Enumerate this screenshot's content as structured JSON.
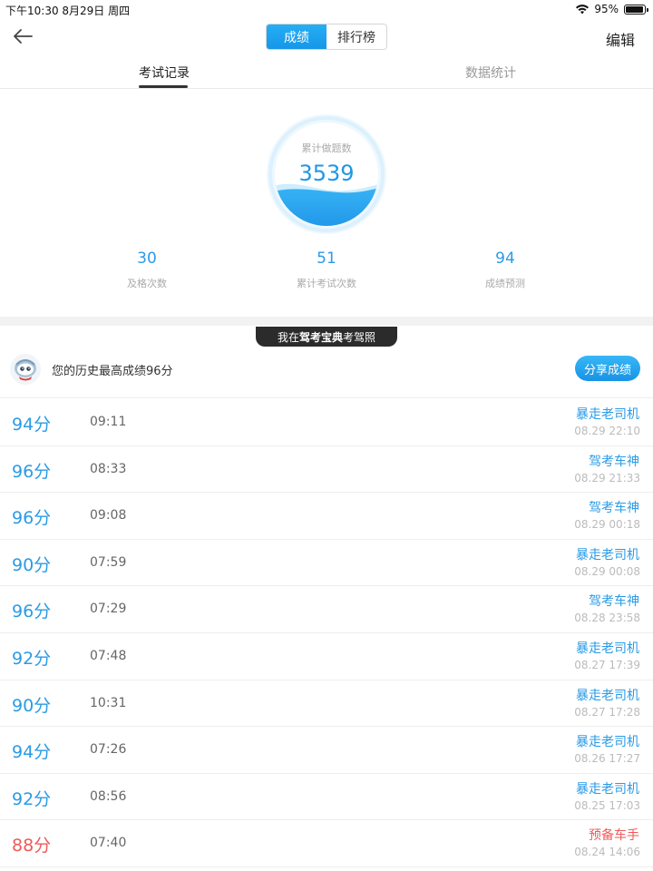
{
  "status": {
    "left": "下午10:30   8月29日 周四",
    "battery": "95%",
    "battery_level": 0.95
  },
  "nav": {
    "segments": [
      {
        "label": "成绩",
        "active": true
      },
      {
        "label": "排行榜",
        "active": false
      }
    ],
    "edit_label": "编辑",
    "back_icon": "arrow-left-icon"
  },
  "tabs": [
    {
      "label": "考试记录",
      "active": true
    },
    {
      "label": "数据统计",
      "active": false
    }
  ],
  "summary": {
    "circle_label": "累计做题数",
    "total_questions": "3539",
    "stats": [
      {
        "value": "30",
        "label": "及格次数"
      },
      {
        "value": "51",
        "label": "累计考试次数"
      },
      {
        "value": "94",
        "label": "成绩预测"
      }
    ]
  },
  "banner": {
    "prefix": "我在",
    "brand": "驾考宝典",
    "suffix": "考驾照"
  },
  "best": {
    "text": "您的历史最高成绩96分",
    "share_label": "分享成绩"
  },
  "records": [
    {
      "score": "94分",
      "duration": "09:11",
      "title": "暴走老司机",
      "date": "08.29 22:10",
      "pass": true
    },
    {
      "score": "96分",
      "duration": "08:33",
      "title": "驾考车神",
      "date": "08.29 21:33",
      "pass": true
    },
    {
      "score": "96分",
      "duration": "09:08",
      "title": "驾考车神",
      "date": "08.29 00:18",
      "pass": true
    },
    {
      "score": "90分",
      "duration": "07:59",
      "title": "暴走老司机",
      "date": "08.29 00:08",
      "pass": true
    },
    {
      "score": "96分",
      "duration": "07:29",
      "title": "驾考车神",
      "date": "08.28 23:58",
      "pass": true
    },
    {
      "score": "92分",
      "duration": "07:48",
      "title": "暴走老司机",
      "date": "08.27 17:39",
      "pass": true
    },
    {
      "score": "90分",
      "duration": "10:31",
      "title": "暴走老司机",
      "date": "08.27 17:28",
      "pass": true
    },
    {
      "score": "94分",
      "duration": "07:26",
      "title": "暴走老司机",
      "date": "08.26 17:27",
      "pass": true
    },
    {
      "score": "92分",
      "duration": "08:56",
      "title": "暴走老司机",
      "date": "08.25 17:03",
      "pass": true
    },
    {
      "score": "88分",
      "duration": "07:40",
      "title": "预备车手",
      "date": "08.24 14:06",
      "pass": false
    }
  ],
  "colors": {
    "accent": "#2a9be6",
    "fail": "#ef5a5a"
  }
}
